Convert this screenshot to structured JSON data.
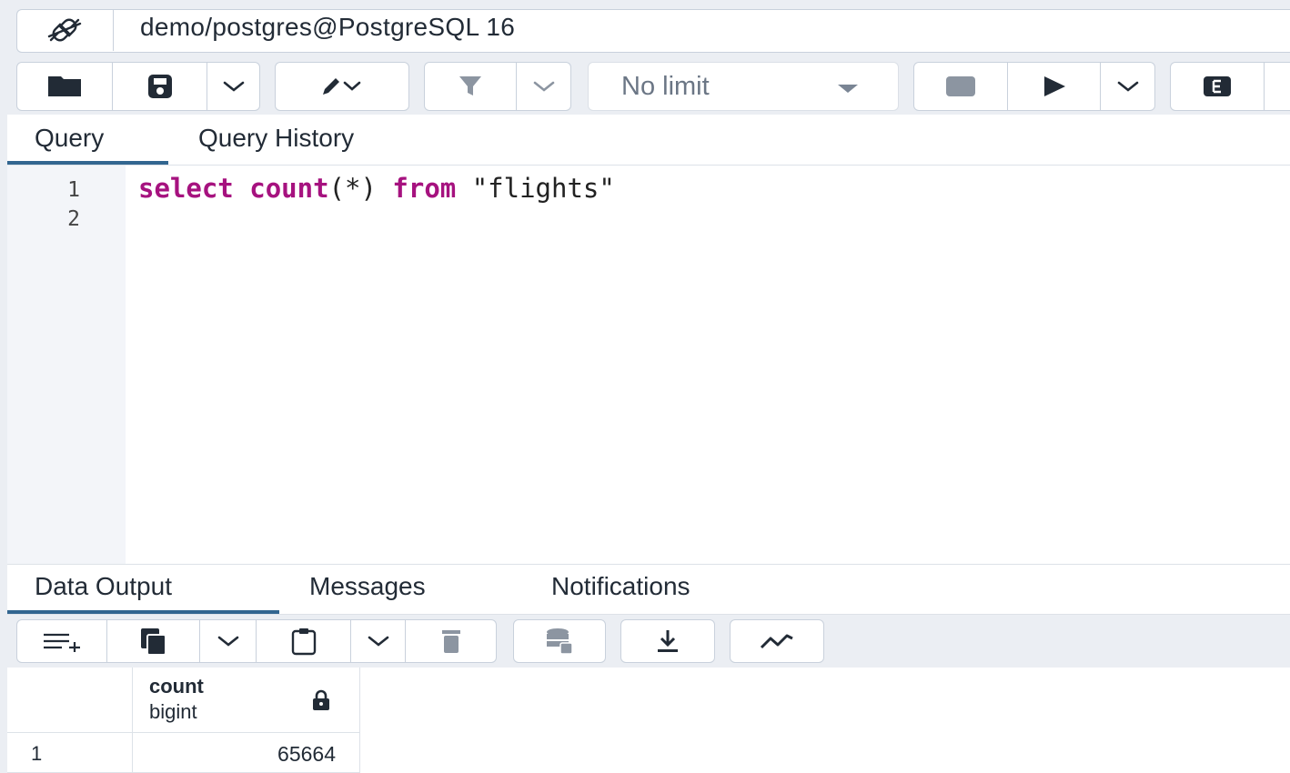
{
  "connection": {
    "label": "demo/postgres@PostgreSQL 16",
    "icon": "connection-plug-icon"
  },
  "toolbar": {
    "limit_value": "No limit",
    "buttons": [
      "open-file",
      "save",
      "save-options",
      "edit",
      "edit-options",
      "filter",
      "filter-options",
      "limit",
      "stop",
      "execute",
      "execute-options",
      "explain"
    ]
  },
  "query_tabs": {
    "items": [
      "Query",
      "Query History"
    ],
    "active": "Query"
  },
  "editor": {
    "line_numbers": [
      "1",
      "2"
    ],
    "tokens": {
      "select": "select",
      "count": "count",
      "args": "(*)",
      "from": "from",
      "table": "\"flights\""
    }
  },
  "output_tabs": {
    "items": [
      "Data Output",
      "Messages",
      "Notifications"
    ],
    "active": "Data Output"
  },
  "grid": {
    "column": {
      "name": "count",
      "type": "bigint",
      "locked": true
    },
    "rows": [
      {
        "num": "1",
        "value": "65664"
      }
    ]
  },
  "colors": {
    "accent": "#326690",
    "keyword": "#a6127f",
    "toolbar_bg": "#ebeef3"
  }
}
